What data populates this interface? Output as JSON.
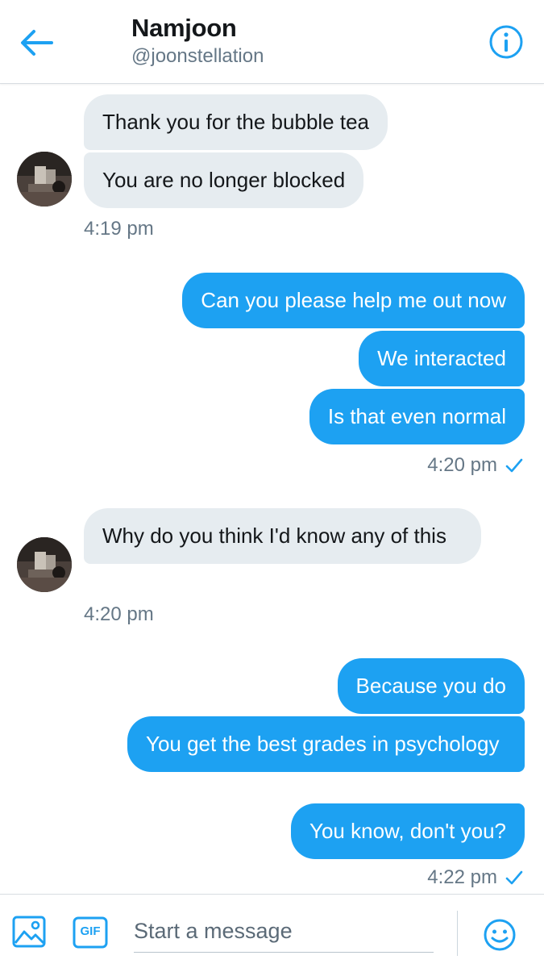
{
  "header": {
    "name": "Namjoon",
    "handle": "@joonstellation",
    "back_icon": "arrow-left-icon",
    "info_icon": "info-icon"
  },
  "colors": {
    "accent": "#1da1f2",
    "received_bubble": "#e6ecf0",
    "muted_text": "#657786"
  },
  "messages": [
    {
      "from": "them",
      "text": "Thank you for the bubble tea"
    },
    {
      "from": "them",
      "text": "You are no longer blocked"
    },
    {
      "time": "4:19 pm"
    },
    {
      "from": "me",
      "text": "Can you please help me out now"
    },
    {
      "from": "me",
      "text": "We interacted"
    },
    {
      "from": "me",
      "text": "Is that even normal"
    },
    {
      "time": "4:20 pm",
      "read": true
    },
    {
      "from": "them",
      "text": "Why do you think I'd know any of this"
    },
    {
      "time": "4:20 pm"
    },
    {
      "from": "me",
      "text": "Because you do"
    },
    {
      "from": "me",
      "text": "You get the best grades in psychology"
    },
    {
      "from": "me",
      "text": "You know, don't you?"
    },
    {
      "time": "4:22 pm",
      "read": true
    }
  ],
  "composer": {
    "placeholder": "Start a message",
    "media_icon": "image-icon",
    "gif_label": "GIF",
    "emoji_icon": "smiley-icon"
  }
}
